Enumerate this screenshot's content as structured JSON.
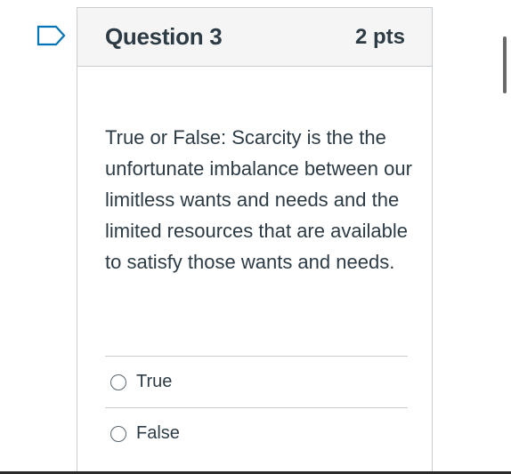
{
  "question": {
    "title": "Question 3",
    "points": "2 pts",
    "text": "True or False: Scarcity is the the unfortunate imbalance between our limitless wants and needs and the limited resources that are available to satisfy those wants and needs."
  },
  "answers": [
    {
      "label": "True",
      "selected": false
    },
    {
      "label": "False",
      "selected": false
    }
  ],
  "icons": {
    "flag": "flag-icon"
  },
  "colors": {
    "header_bg": "#f5f5f5",
    "border": "#c7cdd1",
    "text": "#2d3b45",
    "flag": "#0374b5"
  }
}
